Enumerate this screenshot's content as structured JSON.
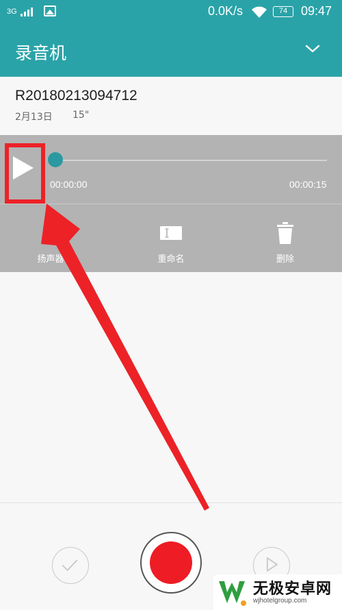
{
  "status_bar": {
    "network": "3G",
    "speed": "0.0K/s",
    "battery": "74",
    "time": "09:47"
  },
  "app_bar": {
    "title": "录音机"
  },
  "recording": {
    "name": "R20180213094712",
    "date": "2月13日",
    "duration": "15\""
  },
  "player": {
    "current_time": "00:00:00",
    "total_time": "00:00:15",
    "progress": 0
  },
  "actions": {
    "speaker_label": "扬声器",
    "rename_label": "重命名",
    "delete_label": "删除"
  },
  "colors": {
    "accent": "#2aa3a8",
    "player_bg": "#b3b3b3",
    "record_red": "#ee1c25",
    "annotation_red": "#ec2227"
  },
  "watermark": {
    "name": "无极安卓网",
    "url": "wjhotelgroup.com"
  }
}
